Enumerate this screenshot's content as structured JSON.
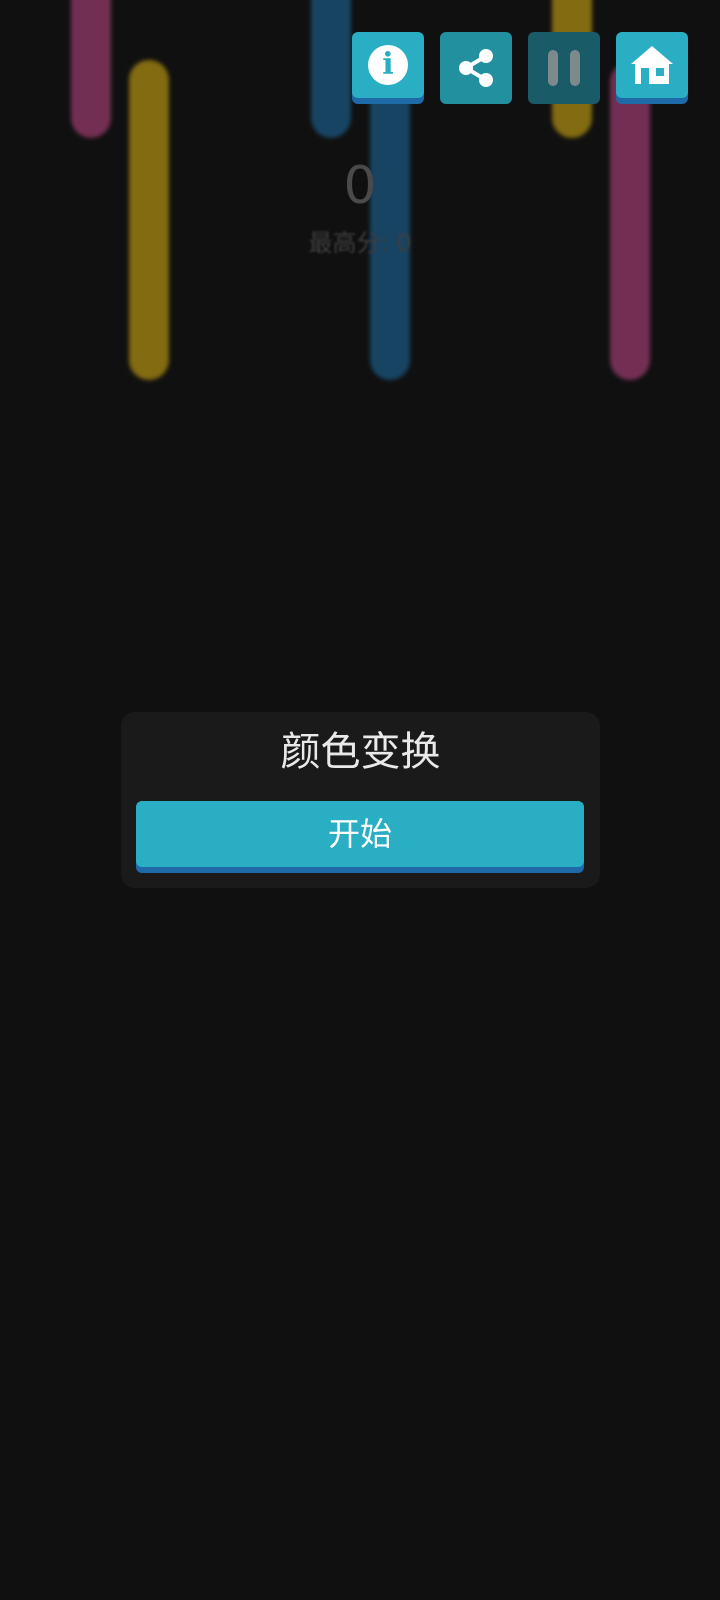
{
  "game": {
    "score": "0",
    "best_score_text": "最高分: 0"
  },
  "toolbar": {
    "info_symbol": "i",
    "accent_color": "#2aaec3",
    "shadow_color": "#1e6aa8"
  },
  "start_panel": {
    "title": "颜色变换",
    "start_label": "开始"
  },
  "bar_colors": {
    "pink": "#c44a8a",
    "yellow": "#e1b614",
    "blue": "#1f6fa8"
  }
}
